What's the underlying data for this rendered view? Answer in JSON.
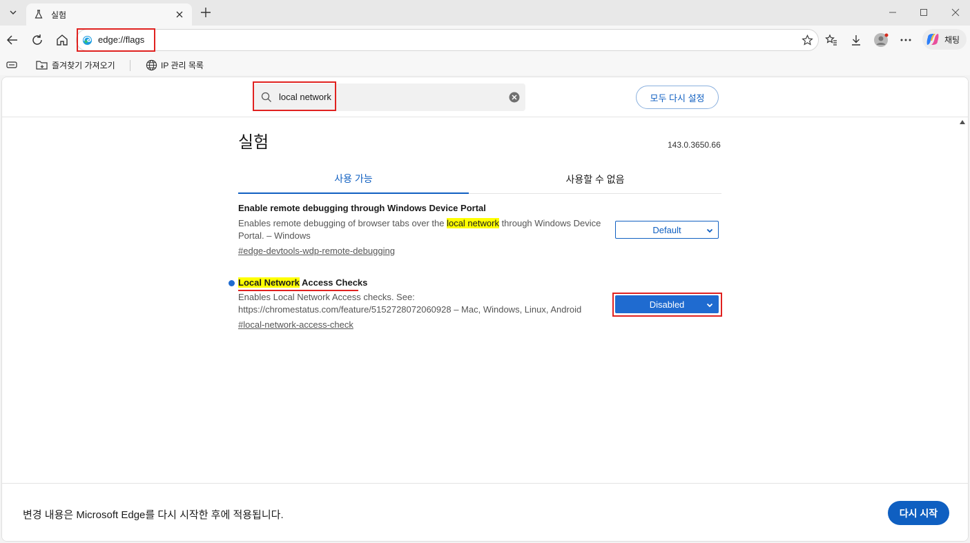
{
  "browser": {
    "tab": {
      "title": "실험",
      "icon": "flask-icon"
    },
    "address": {
      "url": "edge://flags"
    },
    "copilot_label": "채팅",
    "favorites": [
      {
        "label": "즐겨찾기 가져오기",
        "icon": "folder-import-icon"
      },
      {
        "label": "IP 관리 목록",
        "icon": "globe-icon"
      }
    ]
  },
  "search": {
    "value": "local network"
  },
  "reset_label": "모두 다시 설정",
  "title": "실험",
  "version": "143.0.3650.66",
  "tabs": {
    "available": "사용 가능",
    "unavailable": "사용할 수 없음"
  },
  "flags": [
    {
      "title": "Enable remote debugging through Windows Device Portal",
      "desc_before": "Enables remote debugging of browser tabs over the ",
      "desc_highlight": "local network",
      "desc_after": " through Windows Device Portal. – Windows",
      "link": "#edge-devtools-wdp-remote-debugging",
      "selected": "Default"
    },
    {
      "title_highlight": "Local Network",
      "title_rest": " Access Checks",
      "desc": "Enables Local Network Access checks. See: https://chromestatus.com/feature/5152728072060928 – Mac, Windows, Linux, Android",
      "link": "#local-network-access-check",
      "selected": "Disabled"
    }
  ],
  "footer": {
    "message": "변경 내용은 Microsoft Edge를 다시 시작한 후에 적용됩니다.",
    "restart_label": "다시 시작"
  },
  "colors": {
    "accent": "#0f5fc1",
    "highlight_box": "#e0211f",
    "search_mark": "#ffff00"
  }
}
